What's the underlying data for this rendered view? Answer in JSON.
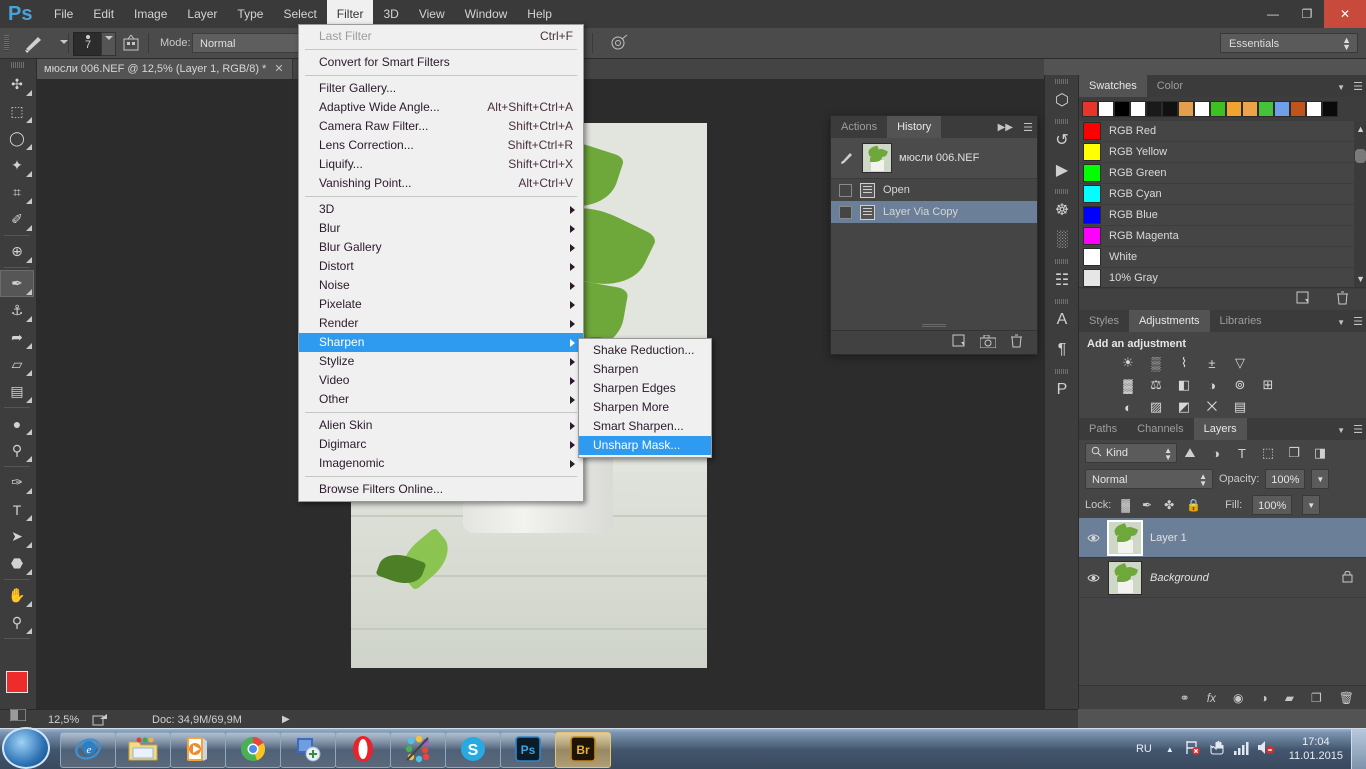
{
  "app": {
    "name": "Adobe Photoshop",
    "logo": "Ps"
  },
  "menubar": {
    "items": [
      {
        "label": "File",
        "active": false
      },
      {
        "label": "Edit",
        "active": false
      },
      {
        "label": "Image",
        "active": false
      },
      {
        "label": "Layer",
        "active": false
      },
      {
        "label": "Type",
        "active": false
      },
      {
        "label": "Select",
        "active": false
      },
      {
        "label": "Filter",
        "active": true
      },
      {
        "label": "3D",
        "active": false
      },
      {
        "label": "View",
        "active": false
      },
      {
        "label": "Window",
        "active": false
      },
      {
        "label": "Help",
        "active": false
      }
    ],
    "window_controls": {
      "minimize": "—",
      "restore": "❐",
      "close": "✕"
    }
  },
  "options_bar": {
    "brush_size": "7",
    "mode_label": "Mode:",
    "mode_value": "Normal",
    "workspace": "Essentials"
  },
  "document_tab": {
    "title": "мюсли 006.NEF @ 12,5% (Layer 1, RGB/8) *",
    "close": "✕"
  },
  "status_bar": {
    "zoom": "12,5%",
    "doc": "Doc: 34,9M/69,9M",
    "arrow": "▶"
  },
  "toolbar": {
    "tools": [
      {
        "name": "move-tool",
        "glyph": "✣",
        "selected": false
      },
      {
        "name": "rectangular-marquee-tool",
        "glyph": "⬚",
        "selected": false
      },
      {
        "name": "lasso-tool",
        "glyph": "◯",
        "selected": false
      },
      {
        "name": "quick-selection-tool",
        "glyph": "✦",
        "selected": false
      },
      {
        "name": "crop-tool",
        "glyph": "⌗",
        "selected": false
      },
      {
        "name": "eyedropper-tool",
        "glyph": "✐",
        "selected": false
      },
      {
        "name": "spot-healing-brush-tool",
        "glyph": "⊕",
        "selected": false
      },
      {
        "name": "brush-tool",
        "glyph": "✒",
        "selected": true
      },
      {
        "name": "clone-stamp-tool",
        "glyph": "⚓",
        "selected": false
      },
      {
        "name": "history-brush-tool",
        "glyph": "➦",
        "selected": false
      },
      {
        "name": "eraser-tool",
        "glyph": "▱",
        "selected": false
      },
      {
        "name": "gradient-tool",
        "glyph": "▤",
        "selected": false
      },
      {
        "name": "blur-tool",
        "glyph": "●",
        "selected": false
      },
      {
        "name": "dodge-tool",
        "glyph": "⚲",
        "selected": false
      },
      {
        "name": "pen-tool",
        "glyph": "✑",
        "selected": false
      },
      {
        "name": "horizontal-type-tool",
        "glyph": "T",
        "selected": false
      },
      {
        "name": "path-selection-tool",
        "glyph": "➤",
        "selected": false
      },
      {
        "name": "polygon-shape-tool",
        "glyph": "⬣",
        "selected": false
      },
      {
        "name": "hand-tool",
        "glyph": "✋",
        "selected": false
      },
      {
        "name": "zoom-tool",
        "glyph": "⚲",
        "selected": false
      }
    ],
    "foreground_color": "#ee2c2c",
    "background_color": "#000000"
  },
  "filter_menu": {
    "groups": [
      [
        {
          "label": "Last Filter",
          "shortcut": "Ctrl+F",
          "disabled": true,
          "submenu": false,
          "highlight": false
        }
      ],
      [
        {
          "label": "Convert for Smart Filters",
          "shortcut": "",
          "disabled": false,
          "submenu": false,
          "highlight": false
        }
      ],
      [
        {
          "label": "Filter Gallery...",
          "shortcut": "",
          "disabled": false,
          "submenu": false,
          "highlight": false
        },
        {
          "label": "Adaptive Wide Angle...",
          "shortcut": "Alt+Shift+Ctrl+A",
          "disabled": false,
          "submenu": false,
          "highlight": false
        },
        {
          "label": "Camera Raw Filter...",
          "shortcut": "Shift+Ctrl+A",
          "disabled": false,
          "submenu": false,
          "highlight": false
        },
        {
          "label": "Lens Correction...",
          "shortcut": "Shift+Ctrl+R",
          "disabled": false,
          "submenu": false,
          "highlight": false
        },
        {
          "label": "Liquify...",
          "shortcut": "Shift+Ctrl+X",
          "disabled": false,
          "submenu": false,
          "highlight": false
        },
        {
          "label": "Vanishing Point...",
          "shortcut": "Alt+Ctrl+V",
          "disabled": false,
          "submenu": false,
          "highlight": false
        }
      ],
      [
        {
          "label": "3D",
          "shortcut": "",
          "disabled": false,
          "submenu": true,
          "highlight": false
        },
        {
          "label": "Blur",
          "shortcut": "",
          "disabled": false,
          "submenu": true,
          "highlight": false
        },
        {
          "label": "Blur Gallery",
          "shortcut": "",
          "disabled": false,
          "submenu": true,
          "highlight": false
        },
        {
          "label": "Distort",
          "shortcut": "",
          "disabled": false,
          "submenu": true,
          "highlight": false
        },
        {
          "label": "Noise",
          "shortcut": "",
          "disabled": false,
          "submenu": true,
          "highlight": false
        },
        {
          "label": "Pixelate",
          "shortcut": "",
          "disabled": false,
          "submenu": true,
          "highlight": false
        },
        {
          "label": "Render",
          "shortcut": "",
          "disabled": false,
          "submenu": true,
          "highlight": false
        },
        {
          "label": "Sharpen",
          "shortcut": "",
          "disabled": false,
          "submenu": true,
          "highlight": true
        },
        {
          "label": "Stylize",
          "shortcut": "",
          "disabled": false,
          "submenu": true,
          "highlight": false
        },
        {
          "label": "Video",
          "shortcut": "",
          "disabled": false,
          "submenu": true,
          "highlight": false
        },
        {
          "label": "Other",
          "shortcut": "",
          "disabled": false,
          "submenu": true,
          "highlight": false
        }
      ],
      [
        {
          "label": "Alien Skin",
          "shortcut": "",
          "disabled": false,
          "submenu": true,
          "highlight": false
        },
        {
          "label": "Digimarc",
          "shortcut": "",
          "disabled": false,
          "submenu": true,
          "highlight": false
        },
        {
          "label": "Imagenomic",
          "shortcut": "",
          "disabled": false,
          "submenu": true,
          "highlight": false
        }
      ],
      [
        {
          "label": "Browse Filters Online...",
          "shortcut": "",
          "disabled": false,
          "submenu": false,
          "highlight": false
        }
      ]
    ]
  },
  "sharpen_submenu": {
    "items": [
      {
        "label": "Shake Reduction...",
        "highlight": false
      },
      {
        "label": "Sharpen",
        "highlight": false
      },
      {
        "label": "Sharpen Edges",
        "highlight": false
      },
      {
        "label": "Sharpen More",
        "highlight": false
      },
      {
        "label": "Smart Sharpen...",
        "highlight": false
      },
      {
        "label": "Unsharp Mask...",
        "highlight": true
      }
    ]
  },
  "history_panel": {
    "tabs": [
      {
        "label": "History",
        "active": true
      },
      {
        "label": "Actions",
        "active": false
      }
    ],
    "snapshot": "мюсли 006.NEF",
    "states": [
      {
        "label": "Open",
        "selected": false
      },
      {
        "label": "Layer Via Copy",
        "selected": true
      }
    ],
    "footer_icons": [
      "new-document-from-state-icon",
      "create-snapshot-icon",
      "delete-state-icon"
    ]
  },
  "rail": {
    "buttons": [
      {
        "name": "3d-panel-icon",
        "glyph": "⬡"
      },
      {
        "name": "history-panel-icon",
        "glyph": "↺"
      },
      {
        "name": "play-actions-icon",
        "glyph": "▶"
      },
      {
        "name": "navigator-panel-icon",
        "glyph": "☸"
      },
      {
        "name": "histogram-panel-icon",
        "glyph": "░"
      },
      {
        "name": "clone-source-panel-icon",
        "glyph": "☷"
      },
      {
        "name": "character-panel-icon",
        "glyph": "A"
      },
      {
        "name": "paragraph-panel-icon",
        "glyph": "¶"
      },
      {
        "name": "properties-panel-icon",
        "glyph": "P"
      }
    ]
  },
  "color_swatches_panel": {
    "tabs": [
      {
        "label": "Color",
        "active": false
      },
      {
        "label": "Swatches",
        "active": true
      }
    ],
    "strip_colors": [
      "#e8352b",
      "#ffffff",
      "#000000",
      "#ffffff",
      "#1a1a1a",
      "#111111",
      "#e2a04e",
      "#ffffff",
      "#3fc021",
      "#f0a32e",
      "#eda34a",
      "#45c13b",
      "#6f9fe8",
      "#c1531d",
      "#ffffff",
      "#0a0a0a"
    ],
    "swatches": [
      {
        "label": "RGB Red",
        "color": "#ff0000"
      },
      {
        "label": "RGB Yellow",
        "color": "#ffff00"
      },
      {
        "label": "RGB Green",
        "color": "#00ff00"
      },
      {
        "label": "RGB Cyan",
        "color": "#00ffff"
      },
      {
        "label": "RGB Blue",
        "color": "#0000ff"
      },
      {
        "label": "RGB Magenta",
        "color": "#ff00ff"
      },
      {
        "label": "White",
        "color": "#ffffff"
      },
      {
        "label": "10% Gray",
        "color": "#e6e6e6"
      }
    ],
    "scroll_up": "▲",
    "scroll_down": "▼"
  },
  "adjustments_panel": {
    "tabs": [
      {
        "label": "Libraries",
        "active": false
      },
      {
        "label": "Adjustments",
        "active": true
      },
      {
        "label": "Styles",
        "active": false
      }
    ],
    "title": "Add an adjustment",
    "rows": [
      [
        {
          "name": "brightness-contrast-icon",
          "glyph": "☀"
        },
        {
          "name": "levels-icon",
          "glyph": "▒"
        },
        {
          "name": "curves-icon",
          "glyph": "⌇"
        },
        {
          "name": "exposure-icon",
          "glyph": "±"
        },
        {
          "name": "vibrance-icon",
          "glyph": "▽"
        }
      ],
      [
        {
          "name": "hue-saturation-icon",
          "glyph": "▓"
        },
        {
          "name": "color-balance-icon",
          "glyph": "⚖"
        },
        {
          "name": "black-and-white-icon",
          "glyph": "◧"
        },
        {
          "name": "photo-filter-icon",
          "glyph": "◑"
        },
        {
          "name": "channel-mixer-icon",
          "glyph": "⊚"
        },
        {
          "name": "color-lookup-icon",
          "glyph": "⊞"
        }
      ],
      [
        {
          "name": "invert-icon",
          "glyph": "◐"
        },
        {
          "name": "posterize-icon",
          "glyph": "▨"
        },
        {
          "name": "threshold-icon",
          "glyph": "◩"
        },
        {
          "name": "selective-color-icon",
          "glyph": "⨉"
        },
        {
          "name": "gradient-map-icon",
          "glyph": "▤"
        }
      ]
    ]
  },
  "layers_panel": {
    "tabs": [
      {
        "label": "Layers",
        "active": true
      },
      {
        "label": "Channels",
        "active": false
      },
      {
        "label": "Paths",
        "active": false
      }
    ],
    "filter_kind": "Kind",
    "filter_icons": [
      {
        "name": "filter-pixel-layers-icon",
        "glyph": "⛰"
      },
      {
        "name": "filter-adjustment-layers-icon",
        "glyph": "◑"
      },
      {
        "name": "filter-type-layers-icon",
        "glyph": "T"
      },
      {
        "name": "filter-shape-layers-icon",
        "glyph": "⬚"
      },
      {
        "name": "filter-smart-objects-icon",
        "glyph": "❐"
      },
      {
        "name": "filter-toggle-icon",
        "glyph": "◨"
      }
    ],
    "blend_mode": "Normal",
    "opacity_label": "Opacity:",
    "opacity_value": "100%",
    "lock_label": "Lock:",
    "lock_icons": [
      {
        "name": "lock-transparent-pixels-icon",
        "glyph": "▓"
      },
      {
        "name": "lock-image-pixels-icon",
        "glyph": "✒"
      },
      {
        "name": "lock-position-icon",
        "glyph": "✤"
      },
      {
        "name": "lock-all-icon",
        "glyph": "🔒"
      }
    ],
    "fill_label": "Fill:",
    "fill_value": "100%",
    "layers": [
      {
        "name": "Layer 1",
        "selected": true,
        "visible": true,
        "locked": false,
        "italic": false
      },
      {
        "name": "Background",
        "selected": false,
        "visible": true,
        "locked": true,
        "italic": true
      }
    ],
    "footer_icons": [
      {
        "name": "link-layers-icon",
        "glyph": "⚭"
      },
      {
        "name": "layer-styles-icon",
        "glyph": "fx"
      },
      {
        "name": "add-layer-mask-icon",
        "glyph": "◉"
      },
      {
        "name": "new-fill-adjustment-layer-icon",
        "glyph": "◑"
      },
      {
        "name": "new-group-icon",
        "glyph": "▰"
      },
      {
        "name": "new-layer-icon",
        "glyph": "❐"
      },
      {
        "name": "delete-layer-icon",
        "glyph": "🗑"
      }
    ]
  },
  "taskbar": {
    "start_name": "windows-start-button",
    "items": [
      {
        "name": "internet-explorer-icon",
        "active": false
      },
      {
        "name": "windows-explorer-icon",
        "active": false
      },
      {
        "name": "media-player-icon",
        "active": false
      },
      {
        "name": "google-chrome-icon",
        "active": false
      },
      {
        "name": "teamviewer-icon",
        "active": false
      },
      {
        "name": "opera-icon",
        "active": false
      },
      {
        "name": "picasa-icon",
        "active": false
      },
      {
        "name": "skype-icon",
        "active": false
      },
      {
        "name": "photoshop-icon",
        "active": false
      },
      {
        "name": "bridge-icon",
        "active": true
      }
    ],
    "tray": {
      "language": "RU",
      "show_hidden": "▲",
      "network_icon": "network-problem-icon",
      "action_center_icon": "action-center-icon",
      "signal_icon": "signal-bars-icon",
      "volume_icon": "volume-muted-icon",
      "time": "17:04",
      "date": "11.01.2015"
    }
  }
}
